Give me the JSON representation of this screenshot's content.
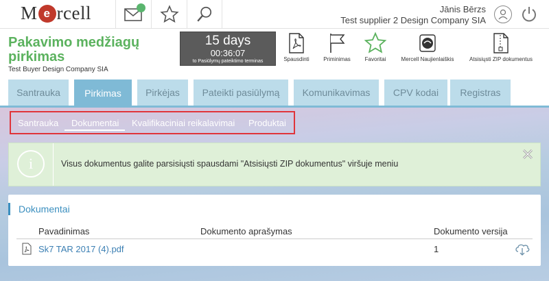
{
  "app": {
    "logo_pre": "M",
    "logo_badge": "e",
    "logo_post": "rcell"
  },
  "user": {
    "name": "Jānis Bērzs",
    "company": "Test supplier 2 Design Company SIA"
  },
  "tender": {
    "title": "Pakavimo medžiagų pirkimas",
    "buyer": "Test Buyer Design Company SIA"
  },
  "countdown": {
    "days": "15 days",
    "time": "00:36:07",
    "label": "to Pasiūlymų pateiktimo terminas"
  },
  "actions": [
    {
      "label": "Spausdinti",
      "icon": "pdf-icon"
    },
    {
      "label": "Priminimas",
      "icon": "flag-icon"
    },
    {
      "label": "Favoritai",
      "icon": "star-icon"
    },
    {
      "label": "Mercell Naujienlaiškis",
      "icon": "newsletter-icon"
    },
    {
      "label": "Atsisiųsti ZIP dokumentus",
      "icon": "zip-icon"
    }
  ],
  "tabs": [
    {
      "label": "Santrauka"
    },
    {
      "label": "Pirkimas",
      "active": true
    },
    {
      "label": "Pirkėjas"
    },
    {
      "label": "Pateikti pasiūlymą"
    },
    {
      "label": "Komunikavimas"
    },
    {
      "label": "CPV kodai"
    },
    {
      "label": "Registras"
    }
  ],
  "subnav": [
    {
      "label": "Santrauka"
    },
    {
      "label": "Dokumentai",
      "active": true
    },
    {
      "label": "Kvalifikaciniai reikalavimai"
    },
    {
      "label": "Produktai"
    }
  ],
  "info": {
    "icon_glyph": "i",
    "message": "Visus dokumentus galite parsisiųsti spausdami \"Atsisiųsti ZIP dokumentus\" viršuje meniu"
  },
  "documents": {
    "title": "Dokumentai",
    "columns": [
      "Pavadinimas",
      "Dokumento aprašymas",
      "Dokumento versija"
    ],
    "rows": [
      {
        "name": "Sk7 TAR 2017 (4).pdf",
        "description": "",
        "version": "1"
      }
    ]
  },
  "colors": {
    "brand_green": "#5bb25e",
    "tab_active": "#7fbad6",
    "tab_inactive": "#bcdcea",
    "highlight_red": "#e0343a",
    "link_blue": "#3b7fb3"
  }
}
